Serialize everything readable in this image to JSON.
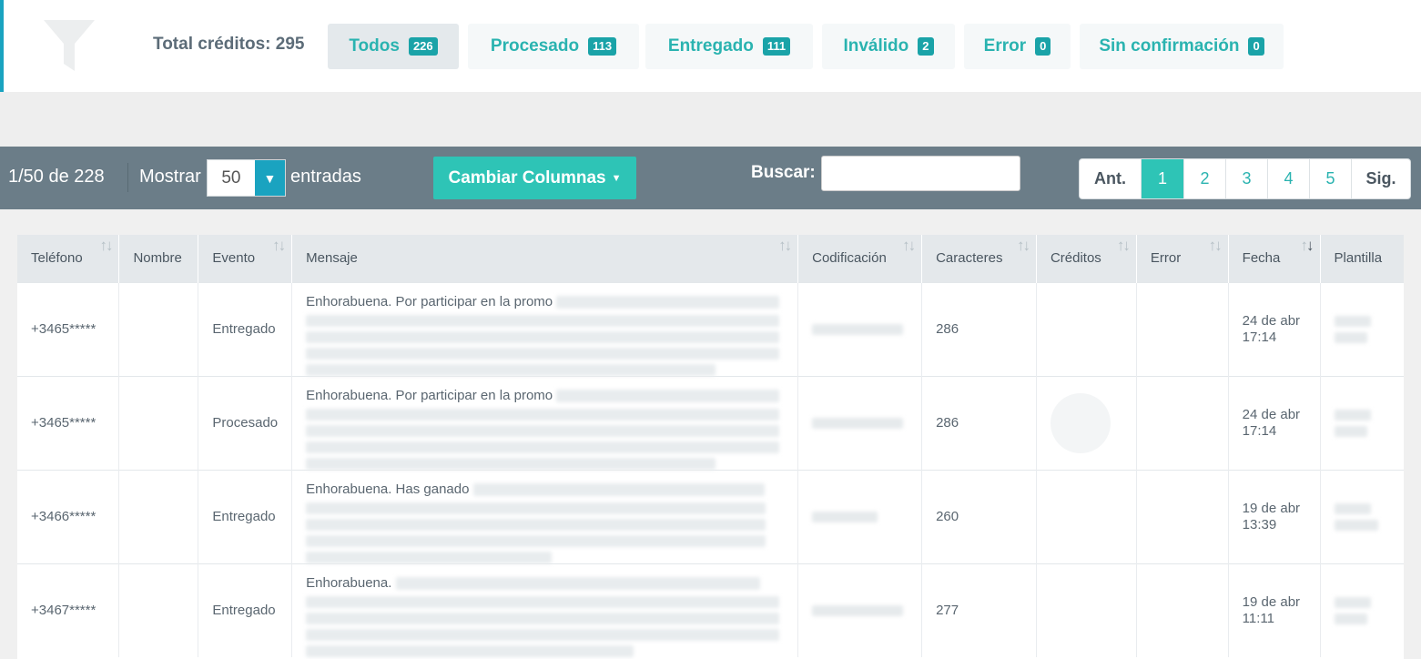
{
  "filters": {
    "total_label": "Total créditos: 295",
    "tabs": [
      {
        "label": "Todos",
        "count": "226"
      },
      {
        "label": "Procesado",
        "count": "113"
      },
      {
        "label": "Entregado",
        "count": "111"
      },
      {
        "label": "Inválido",
        "count": "2"
      },
      {
        "label": "Error",
        "count": "0"
      },
      {
        "label": "Sin confirmación",
        "count": "0"
      }
    ]
  },
  "toolbar": {
    "range": "1/50 de 228",
    "show_label": "Mostrar",
    "show_value": "50",
    "entries_label": "entradas",
    "columns_button": "Cambiar Columnas",
    "search_label": "Buscar:",
    "search_value": ""
  },
  "pagination": {
    "prev": "Ant.",
    "pages": [
      "1",
      "2",
      "3",
      "4",
      "5"
    ],
    "current": "1",
    "next": "Sig."
  },
  "table": {
    "headers": [
      "Teléfono",
      "Nombre",
      "Evento",
      "Mensaje",
      "Codificación",
      "Caracteres",
      "Créditos",
      "Error",
      "Fecha",
      "Plantilla"
    ],
    "rows": [
      {
        "telefono": "+3465*****",
        "nombre": "",
        "evento": "Entregado",
        "mensaje": "Enhorabuena. Por participar en la promo",
        "caracteres": "286",
        "creditos": "",
        "error": "",
        "fecha_1": "24 de abr",
        "fecha_2": "17:14"
      },
      {
        "telefono": "+3465*****",
        "nombre": "",
        "evento": "Procesado",
        "mensaje": "Enhorabuena. Por participar en la promo",
        "caracteres": "286",
        "creditos": "",
        "error": "",
        "fecha_1": "24 de abr",
        "fecha_2": "17:14"
      },
      {
        "telefono": "+3466*****",
        "nombre": "",
        "evento": "Entregado",
        "mensaje": "Enhorabuena. Has ganado",
        "caracteres": "260",
        "creditos": "",
        "error": "",
        "fecha_1": "19 de abr",
        "fecha_2": "13:39"
      },
      {
        "telefono": "+3467*****",
        "nombre": "",
        "evento": "Entregado",
        "mensaje": "Enhorabuena.",
        "caracteres": "277",
        "creditos": "",
        "error": "",
        "fecha_1": "19 de abr",
        "fecha_2": "11:11"
      }
    ]
  },
  "colors": {
    "accent": "#2ec4b6",
    "badge": "#1aa3a8",
    "toolbar_bg": "#6b7d88",
    "header_bg": "#e4e8eb"
  }
}
